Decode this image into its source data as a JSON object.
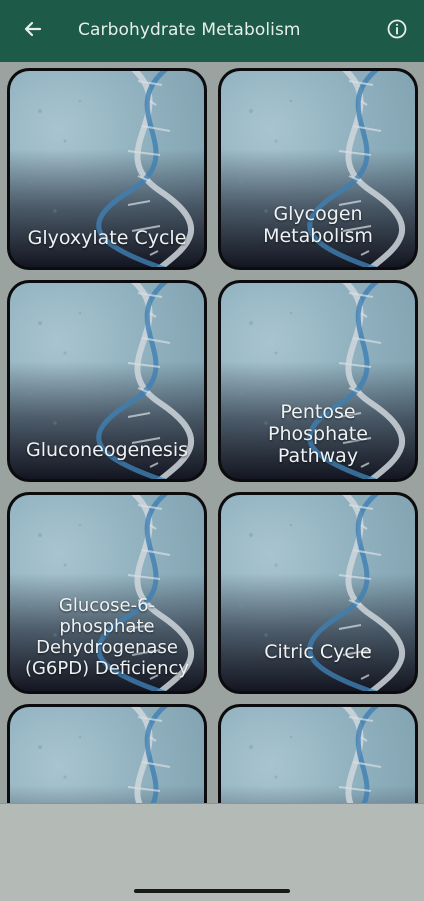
{
  "appbar": {
    "title": "Carbohydrate Metabolism",
    "back_icon": "arrow-left-icon",
    "info_icon": "info-circle-icon",
    "background": "#1e5a48"
  },
  "cards": [
    {
      "label": "Glyoxylate Cycle"
    },
    {
      "label": "Glycogen Metabolism"
    },
    {
      "label": "Gluconeogenesis"
    },
    {
      "label": "Pentose Phosphate Pathway"
    },
    {
      "label": "Glucose-6-phosphate Dehydrogenase (G6PD) Deficiency"
    },
    {
      "label": "Citric Cycle"
    },
    {
      "label": ""
    },
    {
      "label": ""
    }
  ]
}
